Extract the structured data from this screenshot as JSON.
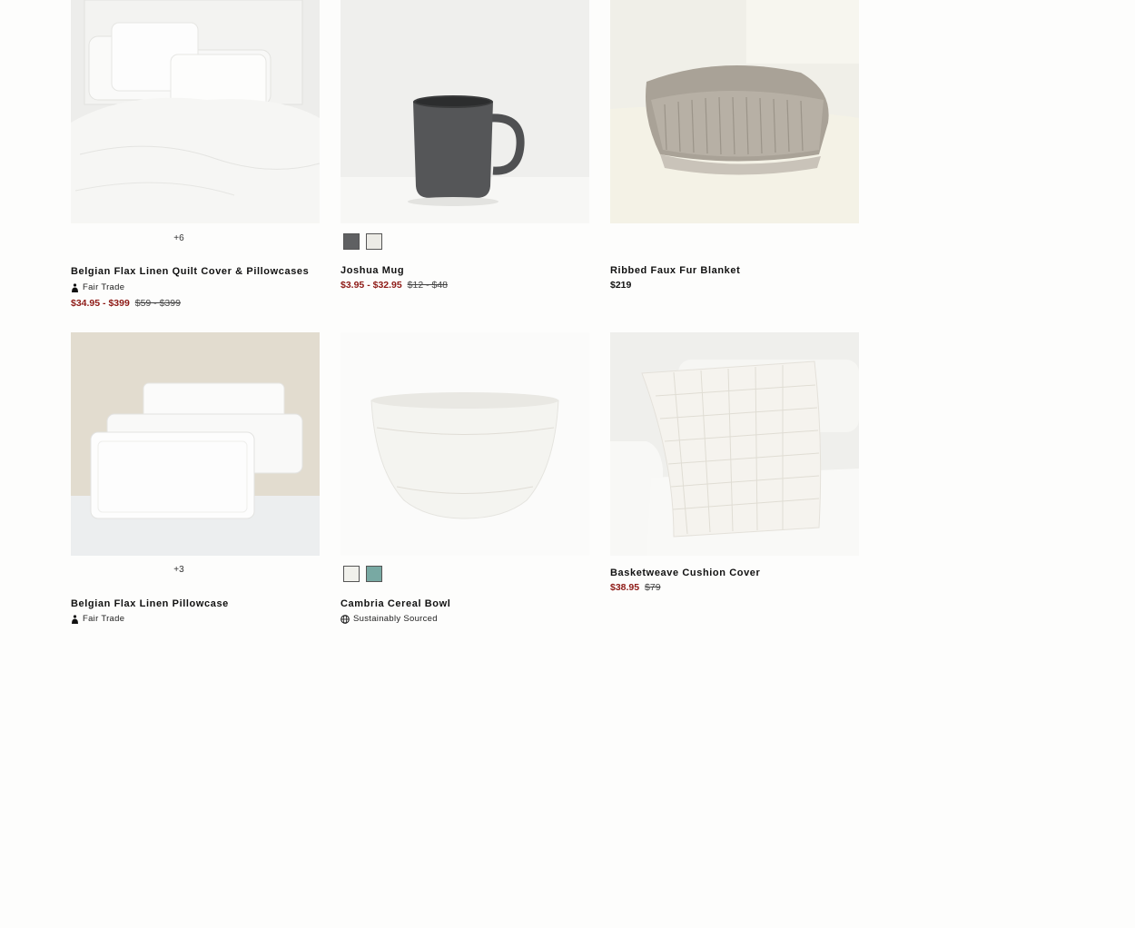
{
  "products": [
    {
      "name": "Belgian Flax Linen Quilt Cover & Pillowcases",
      "more_colors": "+6",
      "badge": "Fair Trade",
      "badge_icon": "fair-trade-icon",
      "sale_price": "$34.95 - $399",
      "original_price": "$59 - $399"
    },
    {
      "name": "Joshua Mug",
      "swatches": [
        "#5f6062",
        "#ecebe6"
      ],
      "sale_price": "$3.95 - $32.95",
      "original_price": "$12 - $48"
    },
    {
      "name": "Ribbed Faux Fur Blanket",
      "price": "$219"
    },
    {
      "name": "Belgian Flax Linen Pillowcase",
      "more_colors": "+3",
      "badge": "Fair Trade",
      "badge_icon": "fair-trade-icon"
    },
    {
      "name": "Cambria Cereal Bowl",
      "swatches": [
        "#f1f1ec",
        "#78a9a3"
      ],
      "badge": "Sustainably Sourced",
      "badge_icon": "globe-icon"
    },
    {
      "name": "Basketweave Cushion Cover",
      "sale_price": "$38.95",
      "original_price": "$79"
    }
  ],
  "colors": {
    "sale": "#8e1a16",
    "text": "#111111",
    "background": "#fdfdfc"
  }
}
